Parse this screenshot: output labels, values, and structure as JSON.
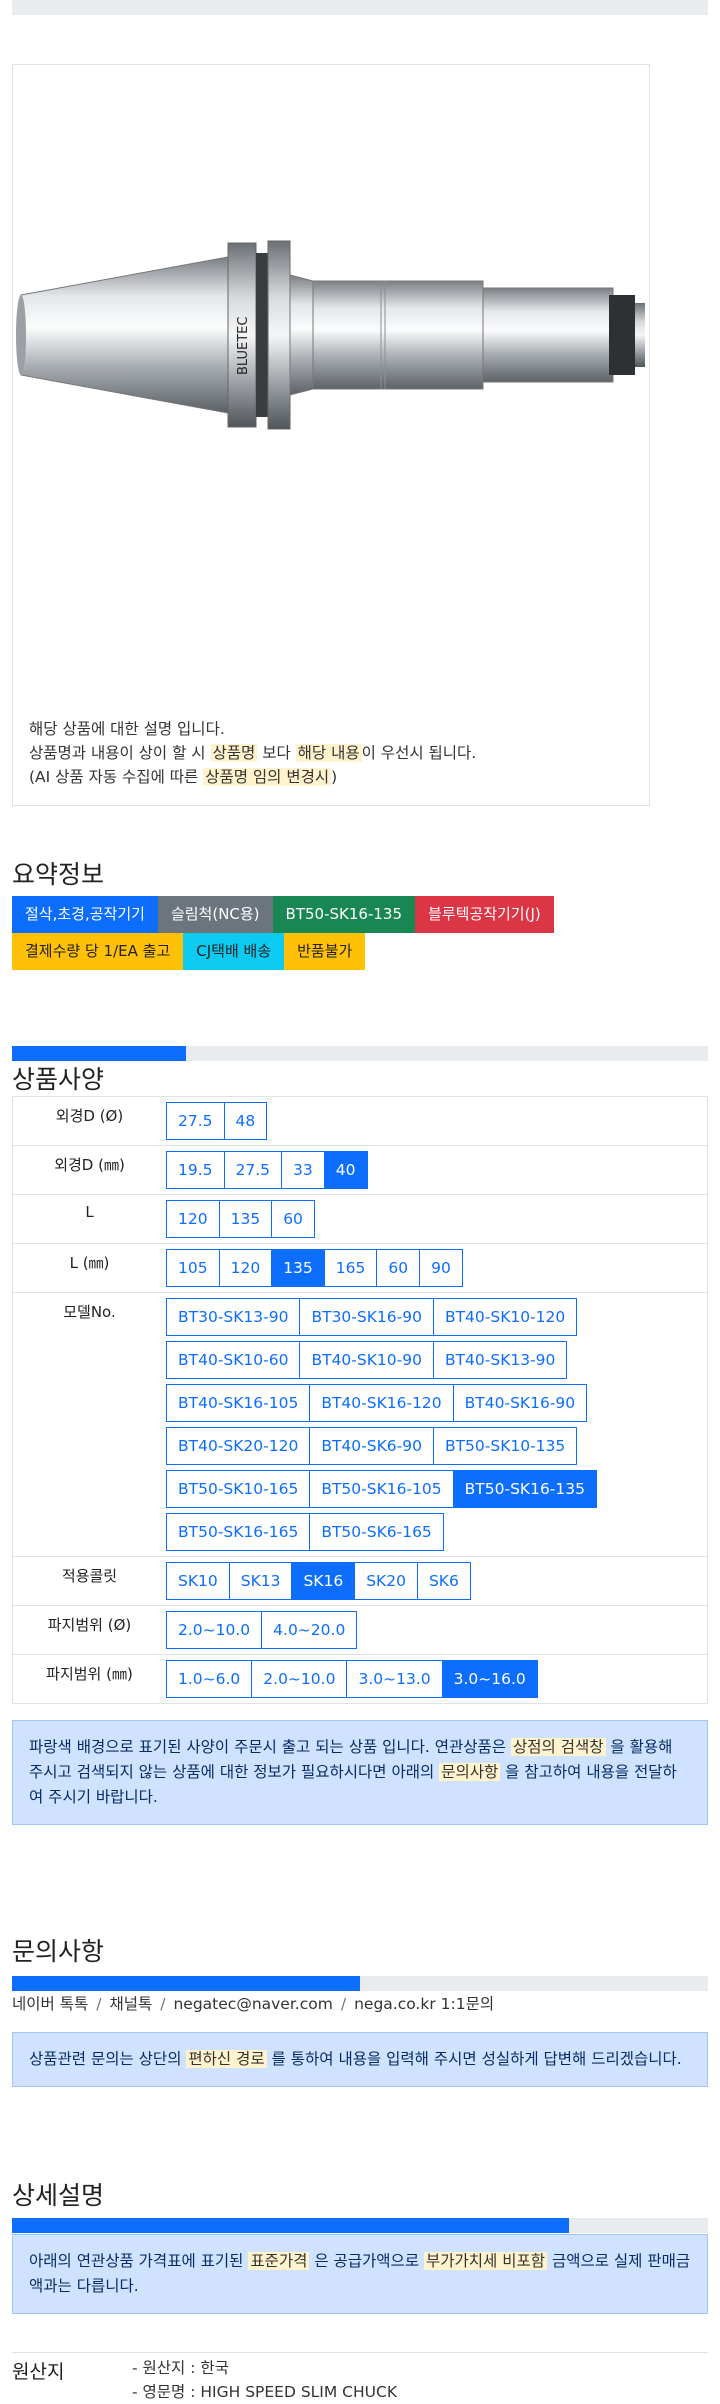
{
  "product_image": {
    "brand_text": "BLUETEC",
    "description": {
      "line1": "해당 상품에 대한 설명 입니다.",
      "line2_pre": "상품명과 내용이 상이 할 시 ",
      "line2_hl1": "상품명",
      "line2_mid": " 보다 ",
      "line2_hl2": "해당 내용",
      "line2_post": "이 우선시 됩니다.",
      "line3_pre": "(AI 상품 자동 수집에 따른 ",
      "line3_hl": "상품명 임의 변경시",
      "line3_post": ")"
    }
  },
  "summary": {
    "title": "요약정보",
    "badges": [
      {
        "label": "절삭,초경,공작기기",
        "color": "#0d6efd"
      },
      {
        "label": "슬림척(NC용)",
        "color": "#6c757d"
      },
      {
        "label": "BT50-SK16-135",
        "color": "#198754"
      },
      {
        "label": "블루텍공작기기(J)",
        "color": "#dc3545"
      },
      {
        "label": "결제수량 당 1/EA 출고",
        "color": "#ffc107"
      },
      {
        "label": "CJ택배 배송",
        "color": "#0dcaf0"
      },
      {
        "label": "반품불가",
        "color": "#ffc107"
      }
    ]
  },
  "spec": {
    "title": "상품사양",
    "progress": 0.25,
    "rows": [
      {
        "label": "외경D (Ø)",
        "options": [
          "27.5",
          "48"
        ],
        "selected": -1
      },
      {
        "label": "외경D (㎜)",
        "options": [
          "19.5",
          "27.5",
          "33",
          "40"
        ],
        "selected": 3
      },
      {
        "label": "L",
        "options": [
          "120",
          "135",
          "60"
        ],
        "selected": -1
      },
      {
        "label": "L (㎜)",
        "options": [
          "105",
          "120",
          "135",
          "165",
          "60",
          "90"
        ],
        "selected": 2
      },
      {
        "label": "모델No.",
        "options": [
          "BT30-SK13-90",
          "BT30-SK16-90",
          "BT40-SK10-120",
          "BT40-SK10-60",
          "BT40-SK10-90",
          "BT40-SK13-90",
          "BT40-SK16-105",
          "BT40-SK16-120",
          "BT40-SK16-90",
          "BT40-SK20-120",
          "BT40-SK6-90",
          "BT50-SK10-135",
          "BT50-SK10-165",
          "BT50-SK16-105",
          "BT50-SK16-135",
          "BT50-SK16-165",
          "BT50-SK6-165"
        ],
        "selected": 14
      },
      {
        "label": "적용콜릿",
        "options": [
          "SK10",
          "SK13",
          "SK16",
          "SK20",
          "SK6"
        ],
        "selected": 2
      },
      {
        "label": "파지범위 (Ø)",
        "options": [
          "2.0~10.0",
          "4.0~20.0"
        ],
        "selected": -1
      },
      {
        "label": "파지범위 (㎜)",
        "options": [
          "1.0~6.0",
          "2.0~10.0",
          "3.0~13.0",
          "3.0~16.0"
        ],
        "selected": 3
      }
    ],
    "notice": {
      "pre": "파랑색 배경으로 표기된 사양이 주문시 출고 되는 상품 입니다. 연관상품은 ",
      "hl1": "상점의 검색창",
      "mid": " 을 활용해 주시고 검색되지 않는 상품에 대한 정보가 필요하시다면 아래의 ",
      "hl2": "문의사항",
      "post": " 을 참고하여 내용을 전달하여 주시기 바랍니다."
    }
  },
  "inquiry": {
    "title": "문의사항",
    "progress": 0.5,
    "contacts": [
      "네이버 톡톡",
      "채널톡",
      "negatec@naver.com",
      "nega.co.kr 1:1문의"
    ],
    "separator": "/",
    "notice": {
      "pre": "상품관련 문의는 상단의 ",
      "hl": "편하신 경로",
      "post": " 를 통하여 내용을 입력해 주시면 성실하게 답변해 드리겠습니다."
    }
  },
  "detail": {
    "title": "상세설명",
    "progress": 0.8,
    "notice": {
      "pre": "아래의 연관상품 가격표에 표기된 ",
      "hl1": "표준가격",
      "mid": " 은 공급가액으로 ",
      "hl2": "부가가치세 비포함",
      "post": " 금액으로 실제 판매금액과는 다릅니다."
    }
  },
  "origin": {
    "label": "원산지",
    "items": [
      "- 원산지 : 한국",
      "- 영문명 : HIGH SPEED SLIM CHUCK"
    ]
  }
}
